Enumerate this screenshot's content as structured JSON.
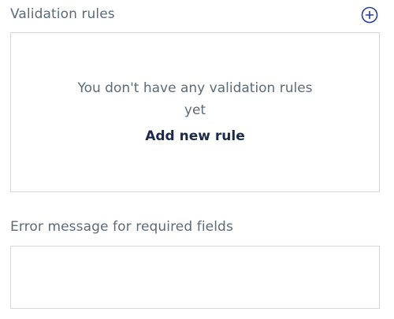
{
  "validation_rules": {
    "title": "Validation rules",
    "add_icon": "plus-circle-icon",
    "empty_state": {
      "message": "You don't have any validation rules yet",
      "add_link_label": "Add new rule"
    }
  },
  "required_error": {
    "label": "Error message for required fields",
    "value": "",
    "placeholder": ""
  },
  "colors": {
    "label_text": "#5c6b7a",
    "link_text": "#1d2b4a",
    "border": "#d3d5e2",
    "icon_accent": "#2a3c9a"
  }
}
